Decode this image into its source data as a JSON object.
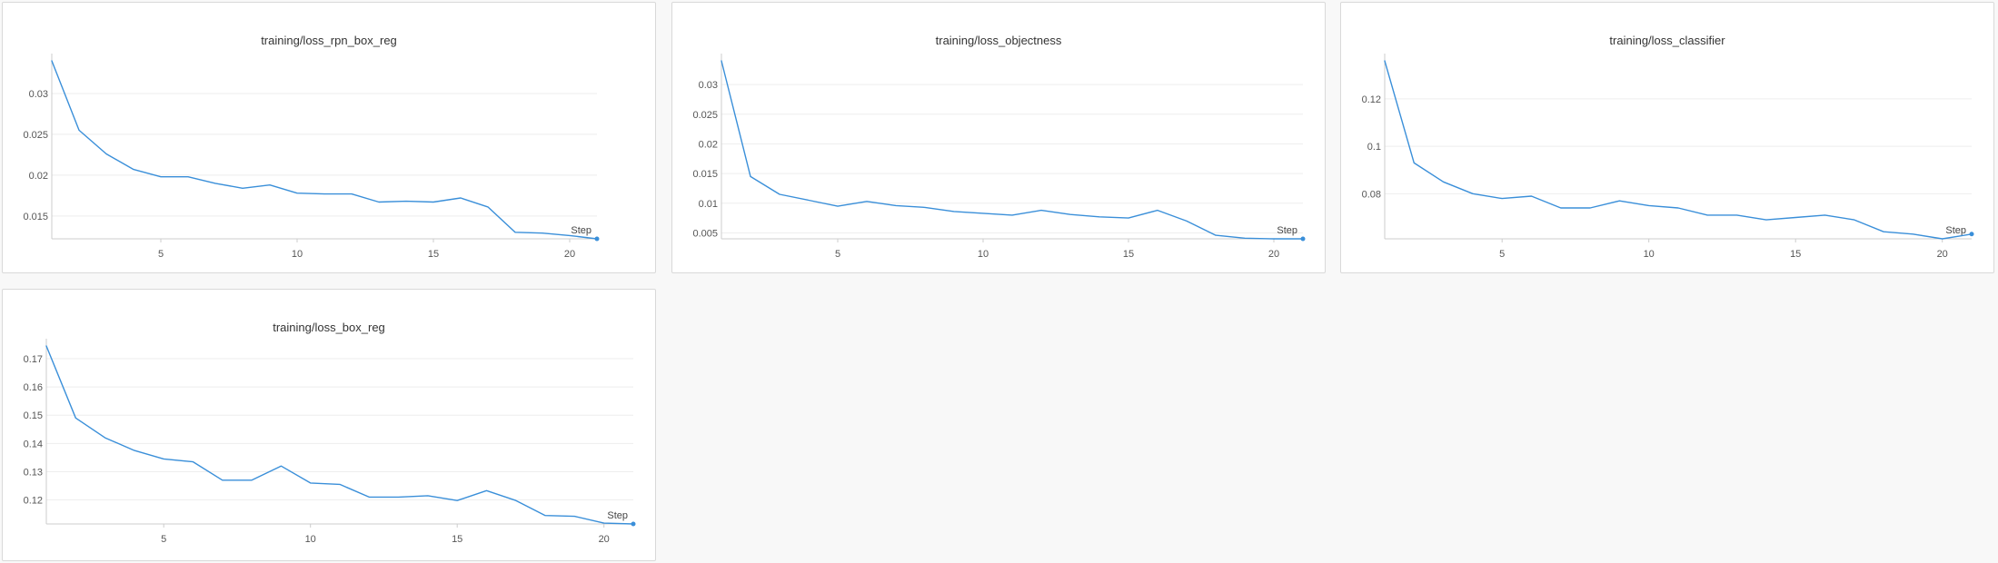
{
  "chart_data": [
    {
      "type": "line",
      "title": "training/loss_rpn_box_reg",
      "xlabel": "Step",
      "x": [
        1,
        2,
        3,
        4,
        5,
        6,
        7,
        8,
        9,
        10,
        11,
        12,
        13,
        14,
        15,
        16,
        17,
        18,
        19,
        20,
        21
      ],
      "series": [
        {
          "values": [
            0.034,
            0.0255,
            0.0226,
            0.0207,
            0.0198,
            0.0198,
            0.019,
            0.0184,
            0.0188,
            0.0178,
            0.0177,
            0.0177,
            0.0167,
            0.0168,
            0.0167,
            0.0172,
            0.0161,
            0.013,
            0.0129,
            0.0126,
            0.0122
          ]
        }
      ],
      "xlim": [
        1,
        21
      ],
      "ylim": [
        0.0122,
        0.034
      ],
      "xticks": [
        5,
        10,
        15,
        20
      ],
      "yticks": [
        0.015,
        0.02,
        0.025,
        0.03
      ],
      "ytick_labels": [
        "0.015",
        "0.02",
        "0.025",
        "0.03"
      ],
      "grid": true
    },
    {
      "type": "line",
      "title": "training/loss_objectness",
      "xlabel": "Step",
      "x": [
        1,
        2,
        3,
        4,
        5,
        6,
        7,
        8,
        9,
        10,
        11,
        12,
        13,
        14,
        15,
        16,
        17,
        18,
        19,
        20,
        21
      ],
      "series": [
        {
          "values": [
            0.034,
            0.0145,
            0.0115,
            0.0105,
            0.0095,
            0.0103,
            0.0096,
            0.0093,
            0.0086,
            0.0083,
            0.008,
            0.0088,
            0.0081,
            0.0077,
            0.0075,
            0.0088,
            0.007,
            0.0046,
            0.0041,
            0.004,
            0.004
          ]
        }
      ],
      "xlim": [
        1,
        21
      ],
      "ylim": [
        0.004,
        0.034
      ],
      "xticks": [
        5,
        10,
        15,
        20
      ],
      "yticks": [
        0.005,
        0.01,
        0.015,
        0.02,
        0.025,
        0.03
      ],
      "ytick_labels": [
        "0.005",
        "0.01",
        "0.015",
        "0.02",
        "0.025",
        "0.03"
      ],
      "grid": true
    },
    {
      "type": "line",
      "title": "training/loss_classifier",
      "xlabel": "Step",
      "x": [
        1,
        2,
        3,
        4,
        5,
        6,
        7,
        8,
        9,
        10,
        11,
        12,
        13,
        14,
        15,
        16,
        17,
        18,
        19,
        20,
        21
      ],
      "series": [
        {
          "values": [
            0.136,
            0.093,
            0.085,
            0.08,
            0.078,
            0.079,
            0.074,
            0.074,
            0.077,
            0.075,
            0.074,
            0.071,
            0.071,
            0.069,
            0.07,
            0.071,
            0.069,
            0.064,
            0.063,
            0.061,
            0.063
          ]
        }
      ],
      "xlim": [
        1,
        21
      ],
      "ylim": [
        0.061,
        0.136
      ],
      "xticks": [
        5,
        10,
        15,
        20
      ],
      "yticks": [
        0.08,
        0.1,
        0.12
      ],
      "ytick_labels": [
        "0.08",
        "0.1",
        "0.12"
      ],
      "grid": true
    },
    {
      "type": "line",
      "title": "training/loss_box_reg",
      "xlabel": "Step",
      "x": [
        1,
        2,
        3,
        4,
        5,
        6,
        7,
        8,
        9,
        10,
        11,
        12,
        13,
        14,
        15,
        16,
        17,
        18,
        19,
        20,
        21
      ],
      "series": [
        {
          "values": [
            0.1745,
            0.149,
            0.142,
            0.1375,
            0.1345,
            0.1335,
            0.127,
            0.127,
            0.132,
            0.126,
            0.1255,
            0.121,
            0.121,
            0.1215,
            0.1198,
            0.1233,
            0.1198,
            0.1145,
            0.1142,
            0.1118,
            0.1115
          ]
        }
      ],
      "xlim": [
        1,
        21
      ],
      "ylim": [
        0.1115,
        0.1745
      ],
      "xticks": [
        5,
        10,
        15,
        20
      ],
      "yticks": [
        0.12,
        0.13,
        0.14,
        0.15,
        0.16,
        0.17
      ],
      "ytick_labels": [
        "0.12",
        "0.13",
        "0.14",
        "0.15",
        "0.16",
        "0.17"
      ],
      "grid": true
    }
  ],
  "colors": {
    "line": "#3a8fd9",
    "grid": "#eeeeee",
    "axis": "#cccccc"
  }
}
